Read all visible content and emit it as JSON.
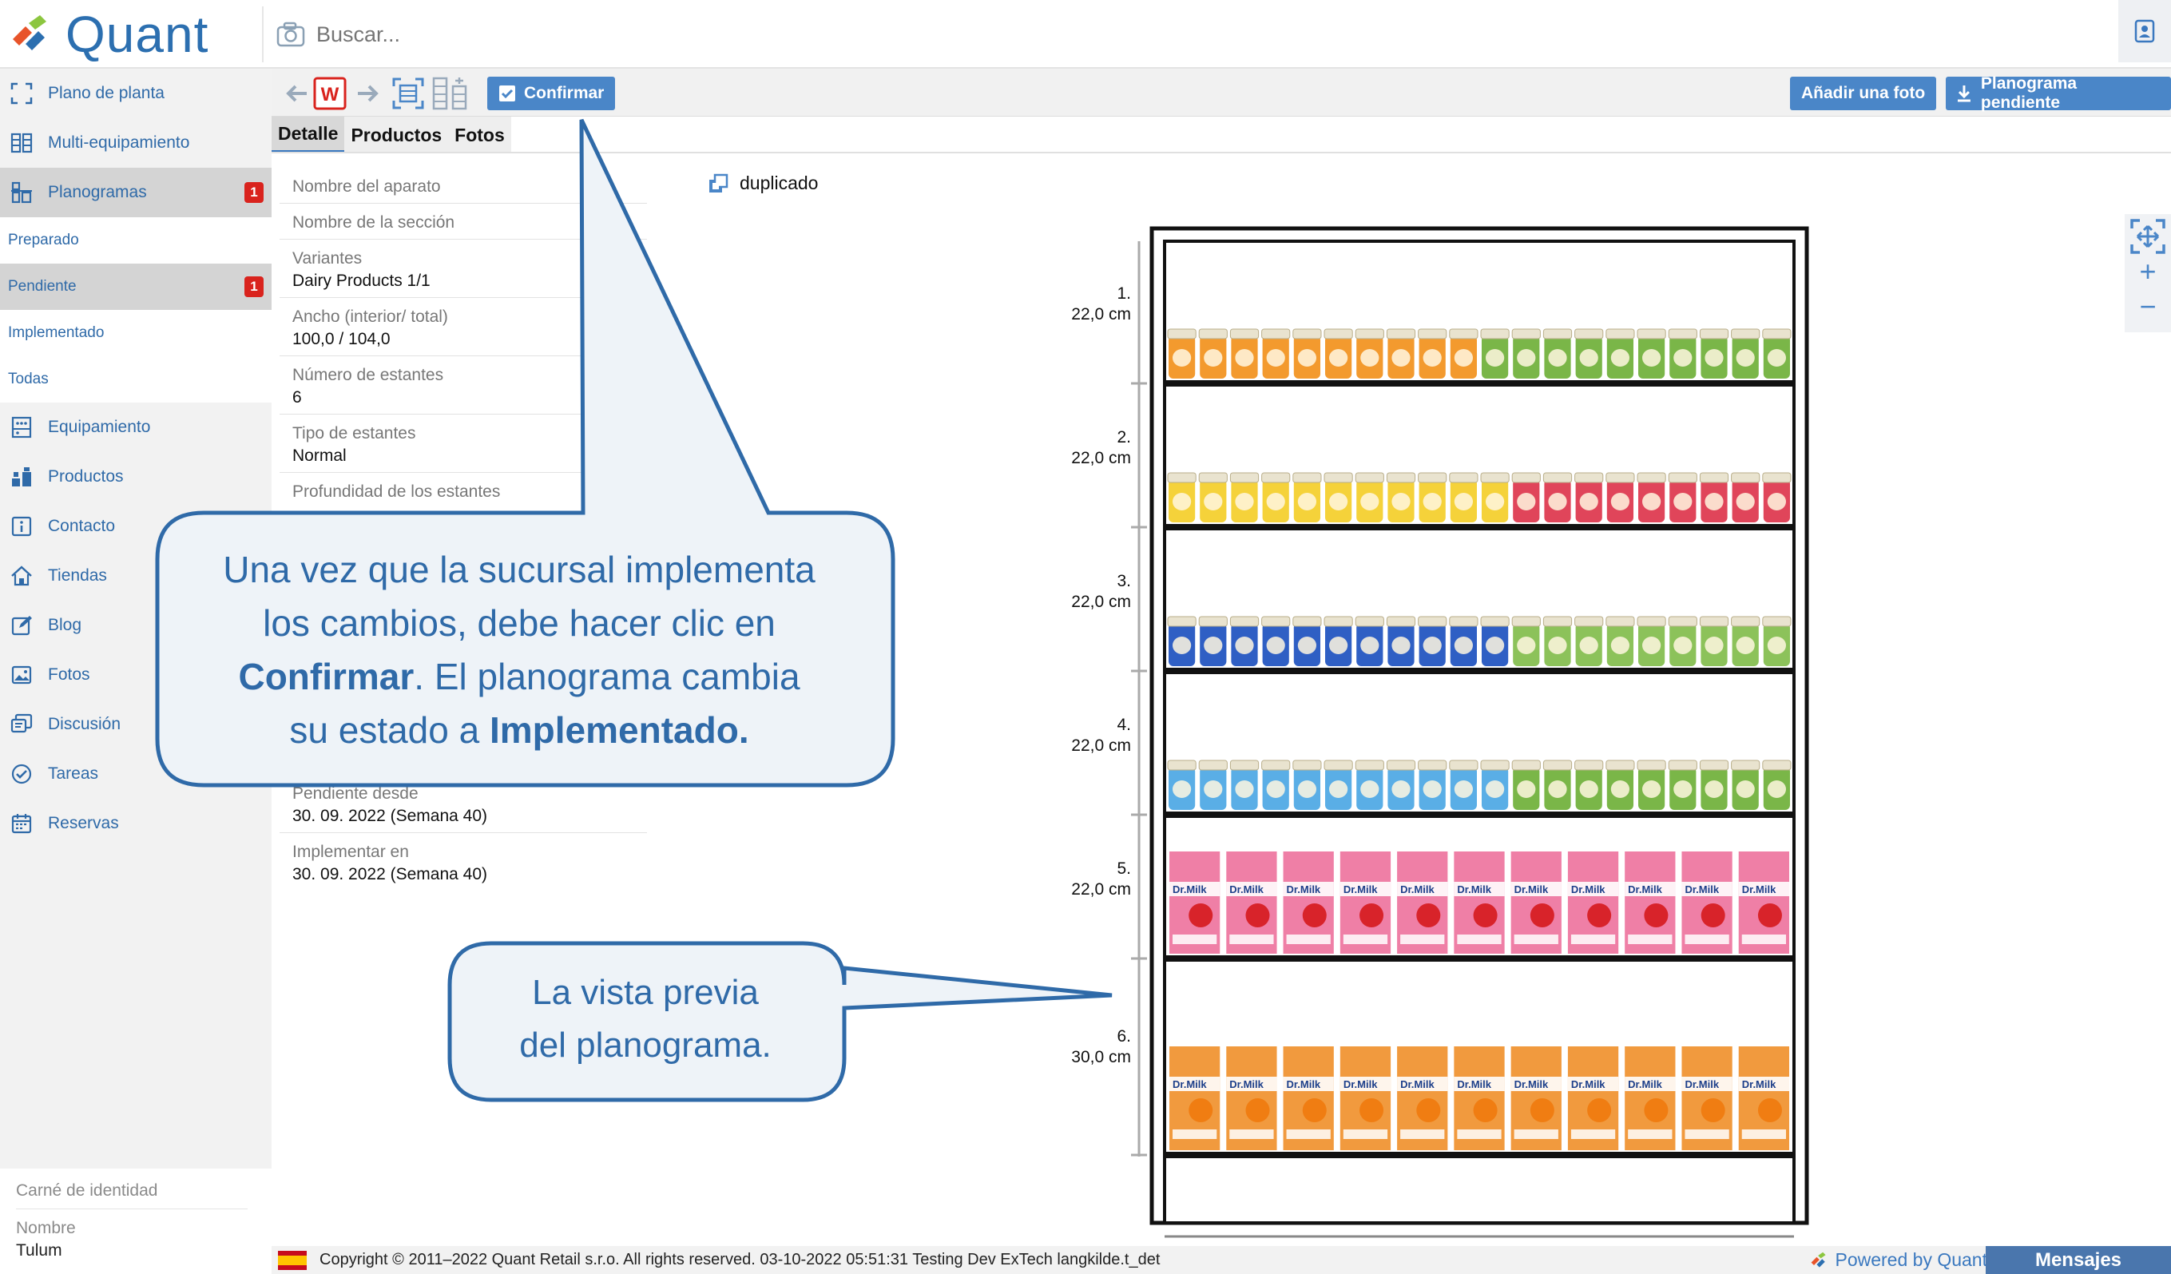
{
  "app": {
    "logo_text": "Quant"
  },
  "search": {
    "placeholder": "Buscar..."
  },
  "sidebar": {
    "items": [
      {
        "label": "Plano de planta"
      },
      {
        "label": "Multi-equipamiento"
      },
      {
        "label": "Planogramas",
        "badge": "1"
      },
      {
        "label": "Equipamiento"
      },
      {
        "label": "Productos"
      },
      {
        "label": "Contacto"
      },
      {
        "label": "Tiendas"
      },
      {
        "label": "Blog"
      },
      {
        "label": "Fotos"
      },
      {
        "label": "Discusión"
      },
      {
        "label": "Tareas"
      },
      {
        "label": "Reservas"
      }
    ],
    "subitems": [
      {
        "label": "Preparado"
      },
      {
        "label": "Pendiente",
        "badge": "1"
      },
      {
        "label": "Implementado"
      },
      {
        "label": "Todas"
      }
    ],
    "bottom": {
      "id_label": "Carné de identidad",
      "name_label": "Nombre",
      "name_value": "Tulum"
    }
  },
  "toolbar": {
    "confirm_label": "Confirmar",
    "add_photo_label": "Añadir una foto",
    "pending_label": "Planograma pendiente"
  },
  "tabs": [
    {
      "label": "Detalle"
    },
    {
      "label": "Productos"
    },
    {
      "label": "Fotos"
    }
  ],
  "details": {
    "device_name_label": "Nombre del aparato",
    "section_name_label": "Nombre de la sección",
    "variants_label": "Variantes",
    "variants_value": "Dairy Products 1/1",
    "width_label": "Ancho (interior/ total)",
    "width_value": "100,0 / 104,0",
    "shelves_label": "Número de estantes",
    "shelves_value": "6",
    "shelf_type_label": "Tipo de estantes",
    "shelf_type_value": "Normal",
    "depth_label": "Profundidad de los estantes",
    "pending_since_label": "Pendiente desde",
    "pending_since_value": "30. 09. 2022 (Semana 40)",
    "implement_label": "Implementar en",
    "implement_value": "30. 09. 2022 (Semana 40)"
  },
  "duplicate_label": "duplicado",
  "planogram": {
    "shelves": [
      {
        "num": "1.",
        "height": "22,0 cm",
        "kind": "jar",
        "colors": [
          "#f39a2e",
          "#f39a2e",
          "#f39a2e",
          "#f39a2e",
          "#f39a2e",
          "#f39a2e",
          "#f39a2e",
          "#f39a2e",
          "#f39a2e",
          "#f39a2e",
          "#7ab648",
          "#7ab648",
          "#7ab648",
          "#7ab648",
          "#7ab648",
          "#7ab648",
          "#7ab648",
          "#7ab648",
          "#7ab648",
          "#7ab648"
        ]
      },
      {
        "num": "2.",
        "height": "22,0 cm",
        "kind": "jar",
        "colors": [
          "#f5d23a",
          "#f5d23a",
          "#f5d23a",
          "#f5d23a",
          "#f5d23a",
          "#f5d23a",
          "#f5d23a",
          "#f5d23a",
          "#f5d23a",
          "#f5d23a",
          "#f5d23a",
          "#e0455a",
          "#e0455a",
          "#e0455a",
          "#e0455a",
          "#e0455a",
          "#e0455a",
          "#e0455a",
          "#e0455a",
          "#e0455a"
        ]
      },
      {
        "num": "3.",
        "height": "22,0 cm",
        "kind": "jar",
        "colors": [
          "#2f5fc4",
          "#2f5fc4",
          "#2f5fc4",
          "#2f5fc4",
          "#2f5fc4",
          "#2f5fc4",
          "#2f5fc4",
          "#2f5fc4",
          "#2f5fc4",
          "#2f5fc4",
          "#2f5fc4",
          "#8cc25a",
          "#8cc25a",
          "#8cc25a",
          "#8cc25a",
          "#8cc25a",
          "#8cc25a",
          "#8cc25a",
          "#8cc25a",
          "#8cc25a"
        ]
      },
      {
        "num": "4.",
        "height": "22,0 cm",
        "kind": "jar",
        "colors": [
          "#5aaee6",
          "#5aaee6",
          "#5aaee6",
          "#5aaee6",
          "#5aaee6",
          "#5aaee6",
          "#5aaee6",
          "#5aaee6",
          "#5aaee6",
          "#5aaee6",
          "#5aaee6",
          "#7ab648",
          "#7ab648",
          "#7ab648",
          "#7ab648",
          "#7ab648",
          "#7ab648",
          "#7ab648",
          "#7ab648",
          "#7ab648"
        ]
      },
      {
        "num": "5.",
        "height": "22,0 cm",
        "kind": "carton",
        "colors": [
          "#ef7fa6",
          "#ef7fa6",
          "#ef7fa6",
          "#ef7fa6",
          "#ef7fa6",
          "#ef7fa6",
          "#ef7fa6",
          "#ef7fa6",
          "#ef7fa6",
          "#ef7fa6",
          "#ef7fa6"
        ]
      },
      {
        "num": "6.",
        "height": "30,0 cm",
        "kind": "carton",
        "colors": [
          "#f19a3e",
          "#f19a3e",
          "#f19a3e",
          "#f19a3e",
          "#f19a3e",
          "#f19a3e",
          "#f19a3e",
          "#f19a3e",
          "#f19a3e",
          "#f19a3e",
          "#f19a3e"
        ]
      }
    ],
    "carton_brand": "Dr.Milk"
  },
  "callout1": {
    "line1": "Una vez que la sucursal implementa",
    "line2": "los cambios, debe hacer clic en",
    "bold1": "Confirmar",
    "line3": ". El planograma cambia",
    "line4": "su estado a ",
    "bold2": "Implementado."
  },
  "callout2": {
    "line1": "La vista previa",
    "line2": "del planograma."
  },
  "footer": {
    "copyright": "Copyright © 2011–2022 Quant Retail s.r.o. All rights reserved. 03-10-2022 05:51:31  Testing Dev ExTech  langkilde.t_det",
    "powered": "Powered by Quant",
    "messages": "Mensajes"
  },
  "colors": {
    "accent": "#4a86c8",
    "link": "#2f6aa8",
    "badge": "#d9231d",
    "callout_fill": "#eef3f8"
  }
}
